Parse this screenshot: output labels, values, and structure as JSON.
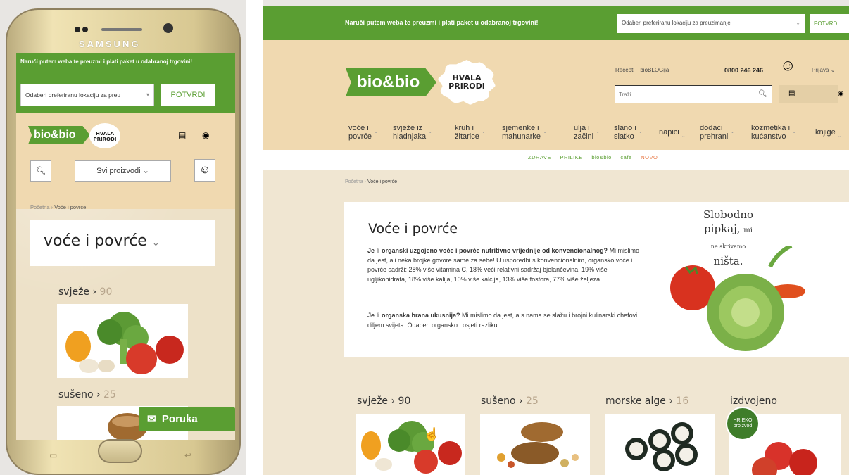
{
  "phone": {
    "brand": "SAMSUNG",
    "banner_text": "Naruči putem weba te preuzmi i plati paket u odabranoj trgovini!",
    "location_select": "Odaberi preferiranu lokaciju za preu",
    "confirm_label": "POTVRDI",
    "logo_text": "bio&bio",
    "hvala_text": "HVALA PRIRODI",
    "all_products_label": "Svi proizvodi",
    "breadcrumb_home": "Početna",
    "breadcrumb_sep": "›",
    "breadcrumb_current": "Voće i povrće",
    "page_title": "voće i povrće",
    "categories": [
      {
        "label": "svježe",
        "count": "90"
      },
      {
        "label": "sušeno",
        "count": "25"
      }
    ],
    "message_button": "Poruka"
  },
  "desktop": {
    "banner_text": "Naruči putem weba te preuzmi i plati paket u odabranoj trgovini!",
    "location_select": "Odaberi preferiranu lokaciju za preuzimanje",
    "confirm_label": "POTVRDI",
    "logo_text": "bio&bio",
    "hvala_text": "HVALA PRIRODI",
    "links": [
      "Recepti",
      "bioBLOGija"
    ],
    "phone_number": "0800 246 246",
    "login_label": "Prijava",
    "search_placeholder": "Traži",
    "nav": [
      {
        "line1": "voće i",
        "line2": "povrće"
      },
      {
        "line1": "svježe iz",
        "line2": "hladnjaka"
      },
      {
        "line1": "kruh i",
        "line2": "žitarice"
      },
      {
        "line1": "sjemenke i",
        "line2": "mahunarke"
      },
      {
        "line1": "ulja i",
        "line2": "začini"
      },
      {
        "line1": "slano i",
        "line2": "slatko"
      },
      {
        "line1": "napici",
        "line2": ""
      },
      {
        "line1": "dodaci",
        "line2": "prehrani"
      },
      {
        "line1": "kozmetika i",
        "line2": "kućanstvo"
      },
      {
        "line1": "knjige",
        "line2": ""
      }
    ],
    "subnav": [
      "ZDRAVE PRILIKE",
      "bio&bio cafe",
      "NOVO"
    ],
    "breadcrumb_home": "Početna",
    "breadcrumb_sep": "›",
    "breadcrumb_current": "Voće i povrće",
    "hero": {
      "title": "Voće i povrće",
      "p1_bold": "Je li organski uzgojeno voće i povrće nutritivno vrijednije od konvencionalnog?",
      "p1_rest": " Mi mislimo da jest, ali neka brojke govore same za sebe! U usporedbi s konvencionalnim, organsko voće i povrće sadrži: 28% više vitamina C, 18% veći relativni sadržaj bjelančevina, 19% više ugljikohidrata, 18% više kalija, 10% više kalcija, 13% više fosfora, 77% više željeza.",
      "p2_bold": "Je li organska hrana ukusnija?",
      "p2_rest": " Mi mislimo da jest, a s nama se slažu i brojni kulinarski chefovi diljem svijeta. Odaberi organsko i osjeti razliku.",
      "slogan_1": "Slobodno",
      "slogan_2": "pipkaj,",
      "slogan_mi": "mi",
      "slogan_3": "ne skrivamo",
      "slogan_4": "ništa."
    },
    "categories": [
      {
        "label": "svježe",
        "count": "90"
      },
      {
        "label": "sušeno",
        "count": "25"
      },
      {
        "label": "morske alge",
        "count": "16"
      },
      {
        "label": "izdvojeno",
        "count": ""
      }
    ],
    "eko_badge": "HR EKO proizvod"
  }
}
